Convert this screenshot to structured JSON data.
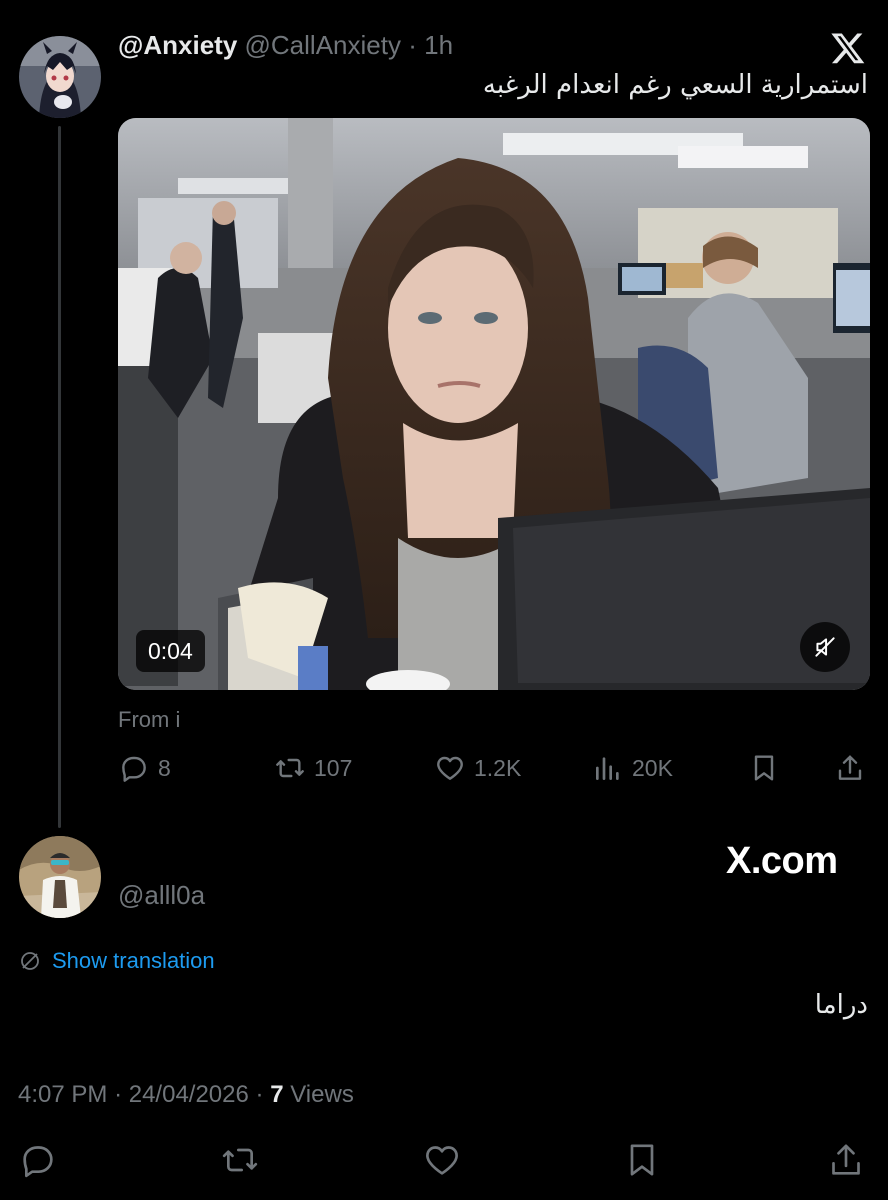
{
  "post": {
    "display_name": "@Anxiety",
    "handle": "@CallAnxiety",
    "separator": "·",
    "time": "1h",
    "text": "استمرارية السعي رغم انعدام الرغبه",
    "media": {
      "duration": "0:04"
    },
    "from_label": "From i",
    "stats": {
      "replies": "8",
      "retweets": "107",
      "likes": "1.2K",
      "views": "20K"
    }
  },
  "watermark": "X.com",
  "reply": {
    "handle": "@alll0a",
    "show_translation": "Show translation",
    "text": "دراما",
    "time": "4:07 PM",
    "date": "24/04/2026",
    "separator": "·",
    "views_count": "7",
    "views_label": "Views"
  },
  "colors": {
    "background": "#000000",
    "primary_text": "#e7e9ea",
    "secondary_text": "#71767b",
    "link": "#1d9bf0",
    "thread_line": "#333639"
  },
  "icons": [
    "x-logo-icon",
    "mute-icon",
    "reply-icon",
    "retweet-icon",
    "like-icon",
    "views-icon",
    "bookmark-icon",
    "share-icon",
    "translate-icon"
  ]
}
